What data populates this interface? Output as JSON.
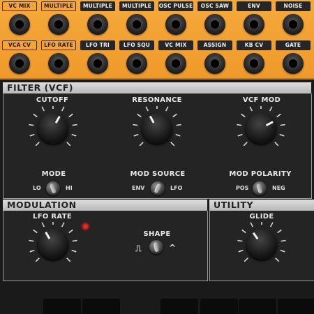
{
  "patchbay": {
    "row1": [
      "VC MIX",
      "MULTIPLE",
      "MULTIPLE",
      "MULTIPLE",
      "OSC PULSE",
      "OSC SAW",
      "ENV",
      "NOISE"
    ],
    "row2": [
      "VCA CV",
      "LFO RATE",
      "LFO TRI",
      "LFO SQU",
      "VC MIX",
      "ASSIGN",
      "KB CV",
      "GATE"
    ]
  },
  "filter": {
    "title": "FILTER (VCF)",
    "cutoff": "CUTOFF",
    "resonance": "RESONANCE",
    "vcf_mod": "VCF MOD",
    "mode": "MODE",
    "mode_lo": "LO",
    "mode_hi": "HI",
    "mod_source": "MOD SOURCE",
    "src_env": "ENV",
    "src_lfo": "LFO",
    "mod_polarity": "MOD POLARITY",
    "pol_pos": "POS",
    "pol_neg": "NEG"
  },
  "modulation": {
    "title": "MODULATION",
    "lfo_rate": "LFO RATE",
    "shape": "SHAPE"
  },
  "utility": {
    "title": "UTILITY",
    "glide": "GLIDE"
  },
  "colors": {
    "patch_orange": "#f4a534",
    "led_red": "#ff2a1a"
  }
}
